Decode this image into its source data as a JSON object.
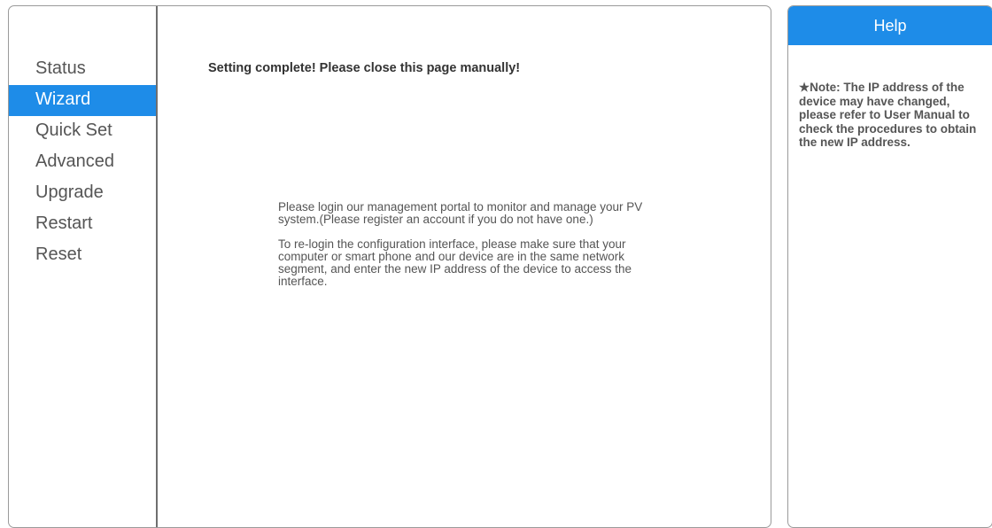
{
  "sidebar": {
    "items": [
      {
        "label": "Status",
        "active": false
      },
      {
        "label": "Wizard",
        "active": true
      },
      {
        "label": "Quick Set",
        "active": false
      },
      {
        "label": "Advanced",
        "active": false
      },
      {
        "label": "Upgrade",
        "active": false
      },
      {
        "label": "Restart",
        "active": false
      },
      {
        "label": "Reset",
        "active": false
      }
    ]
  },
  "main": {
    "complete_message": "Setting complete! Please close this page manually!",
    "portal_text": "Please login our management portal to monitor and manage your PV system.(Please register an account if you do not have one.)",
    "relogin_text": "To re-login the configuration interface, please make sure that your computer or smart phone and our device are in the same network segment, and enter the new IP address of the device to access the interface."
  },
  "help": {
    "title": "Help",
    "note": "★Note: The IP address of the device may have changed, please refer to User Manual to check the procedures to obtain the new IP address."
  },
  "colors": {
    "accent": "#1e8ce8",
    "text": "#555555",
    "border": "#9a9a9a"
  }
}
